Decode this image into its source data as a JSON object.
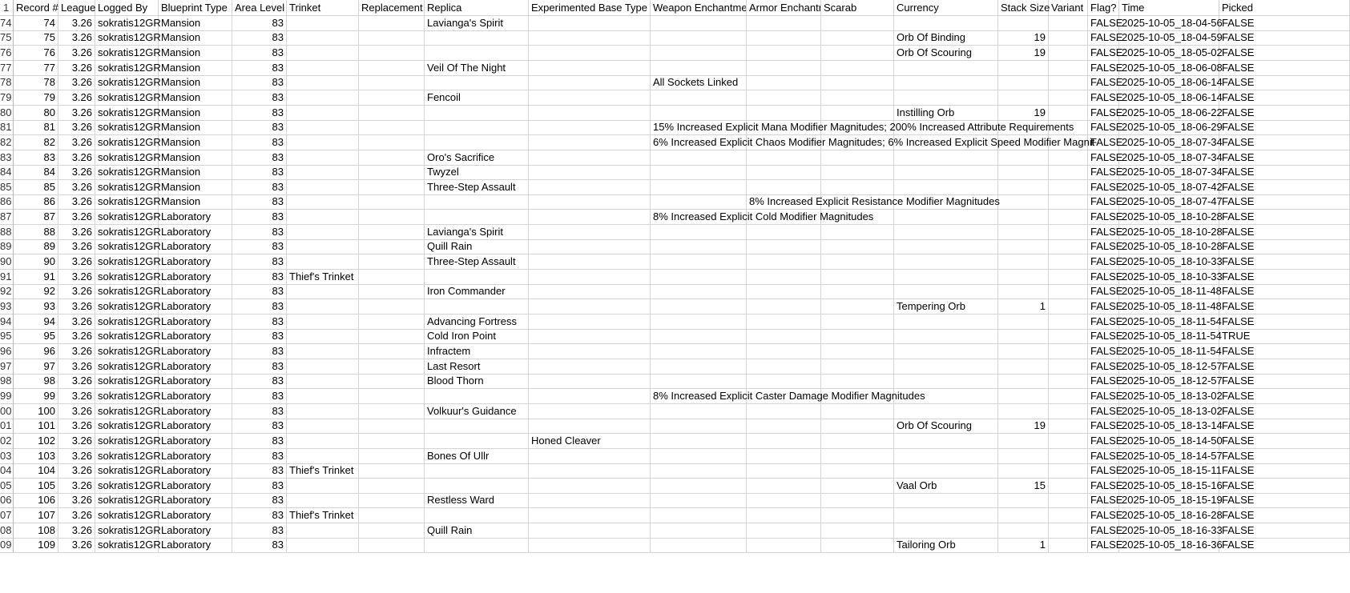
{
  "header": {
    "row_label": "1",
    "columns": [
      "Record #",
      "League",
      "Logged By",
      "Blueprint Type",
      "Area Level",
      "Trinket",
      "Replacement",
      "Replica",
      "Experimented Base Type",
      "Weapon Enchantme",
      "Armor Enchantm",
      "Scarab",
      "Currency",
      "Stack Size",
      "Variant",
      "Flag?",
      "Time",
      "Picked"
    ]
  },
  "rows": [
    [
      "74",
      "74",
      "3.26",
      "sokratis12GR",
      "Mansion",
      "83",
      "",
      "",
      "Lavianga's Spirit",
      "",
      "",
      "",
      "",
      "",
      "",
      "",
      "FALSE",
      "2025-10-05_18-04-56",
      "FALSE"
    ],
    [
      "75",
      "75",
      "3.26",
      "sokratis12GR",
      "Mansion",
      "83",
      "",
      "",
      "",
      "",
      "",
      "",
      "",
      "Orb Of Binding",
      "19",
      "",
      "FALSE",
      "2025-10-05_18-04-59",
      "FALSE"
    ],
    [
      "76",
      "76",
      "3.26",
      "sokratis12GR",
      "Mansion",
      "83",
      "",
      "",
      "",
      "",
      "",
      "",
      "",
      "Orb Of Scouring",
      "19",
      "",
      "FALSE",
      "2025-10-05_18-05-02",
      "FALSE"
    ],
    [
      "77",
      "77",
      "3.26",
      "sokratis12GR",
      "Mansion",
      "83",
      "",
      "",
      "Veil Of The Night",
      "",
      "",
      "",
      "",
      "",
      "",
      "",
      "FALSE",
      "2025-10-05_18-06-08",
      "FALSE"
    ],
    [
      "78",
      "78",
      "3.26",
      "sokratis12GR",
      "Mansion",
      "83",
      "",
      "",
      "",
      "",
      "All Sockets Linked",
      "",
      "",
      "",
      "",
      "",
      "FALSE",
      "2025-10-05_18-06-14",
      "FALSE"
    ],
    [
      "79",
      "79",
      "3.26",
      "sokratis12GR",
      "Mansion",
      "83",
      "",
      "",
      "Fencoil",
      "",
      "",
      "",
      "",
      "",
      "",
      "",
      "FALSE",
      "2025-10-05_18-06-14",
      "FALSE"
    ],
    [
      "80",
      "80",
      "3.26",
      "sokratis12GR",
      "Mansion",
      "83",
      "",
      "",
      "",
      "",
      "",
      "",
      "",
      "Instilling Orb",
      "19",
      "",
      "FALSE",
      "2025-10-05_18-06-22",
      "FALSE"
    ],
    [
      "81",
      "81",
      "3.26",
      "sokratis12GR",
      "Mansion",
      "83",
      "",
      "",
      "",
      "",
      "15% Increased Explicit Mana Modifier Magnitudes; 200% Increased Attribute Requirements",
      "",
      "",
      "",
      "",
      "",
      "FALSE",
      "2025-10-05_18-06-29",
      "FALSE"
    ],
    [
      "82",
      "82",
      "3.26",
      "sokratis12GR",
      "Mansion",
      "83",
      "",
      "",
      "",
      "",
      "6% Increased Explicit Chaos Modifier Magnitudes; 6% Increased Explicit Speed Modifier Magnit",
      "",
      "",
      "",
      "",
      "",
      "FALSE",
      "2025-10-05_18-07-34",
      "FALSE"
    ],
    [
      "83",
      "83",
      "3.26",
      "sokratis12GR",
      "Mansion",
      "83",
      "",
      "",
      "Oro's Sacrifice",
      "",
      "",
      "",
      "",
      "",
      "",
      "",
      "FALSE",
      "2025-10-05_18-07-34",
      "FALSE"
    ],
    [
      "84",
      "84",
      "3.26",
      "sokratis12GR",
      "Mansion",
      "83",
      "",
      "",
      "Twyzel",
      "",
      "",
      "",
      "",
      "",
      "",
      "",
      "FALSE",
      "2025-10-05_18-07-34",
      "FALSE"
    ],
    [
      "85",
      "85",
      "3.26",
      "sokratis12GR",
      "Mansion",
      "83",
      "",
      "",
      "Three-Step Assault",
      "",
      "",
      "",
      "",
      "",
      "",
      "",
      "FALSE",
      "2025-10-05_18-07-42",
      "FALSE"
    ],
    [
      "86",
      "86",
      "3.26",
      "sokratis12GR",
      "Mansion",
      "83",
      "",
      "",
      "",
      "",
      "",
      "8% Increased Explicit Resistance Modifier Magnitudes",
      "",
      "",
      "",
      "",
      "FALSE",
      "2025-10-05_18-07-47",
      "FALSE"
    ],
    [
      "87",
      "87",
      "3.26",
      "sokratis12GR",
      "Laboratory",
      "83",
      "",
      "",
      "",
      "",
      "8% Increased Explicit Cold Modifier Magnitudes",
      "",
      "",
      "",
      "",
      "",
      "FALSE",
      "2025-10-05_18-10-28",
      "FALSE"
    ],
    [
      "88",
      "88",
      "3.26",
      "sokratis12GR",
      "Laboratory",
      "83",
      "",
      "",
      "Lavianga's Spirit",
      "",
      "",
      "",
      "",
      "",
      "",
      "",
      "FALSE",
      "2025-10-05_18-10-28",
      "FALSE"
    ],
    [
      "89",
      "89",
      "3.26",
      "sokratis12GR",
      "Laboratory",
      "83",
      "",
      "",
      "Quill Rain",
      "",
      "",
      "",
      "",
      "",
      "",
      "",
      "FALSE",
      "2025-10-05_18-10-28",
      "FALSE"
    ],
    [
      "90",
      "90",
      "3.26",
      "sokratis12GR",
      "Laboratory",
      "83",
      "",
      "",
      "Three-Step Assault",
      "",
      "",
      "",
      "",
      "",
      "",
      "",
      "FALSE",
      "2025-10-05_18-10-33",
      "FALSE"
    ],
    [
      "91",
      "91",
      "3.26",
      "sokratis12GR",
      "Laboratory",
      "83",
      "Thief's Trinket",
      "",
      "",
      "",
      "",
      "",
      "",
      "",
      "",
      "",
      "FALSE",
      "2025-10-05_18-10-33",
      "FALSE"
    ],
    [
      "92",
      "92",
      "3.26",
      "sokratis12GR",
      "Laboratory",
      "83",
      "",
      "",
      "Iron Commander",
      "",
      "",
      "",
      "",
      "",
      "",
      "",
      "FALSE",
      "2025-10-05_18-11-48",
      "FALSE"
    ],
    [
      "93",
      "93",
      "3.26",
      "sokratis12GR",
      "Laboratory",
      "83",
      "",
      "",
      "",
      "",
      "",
      "",
      "",
      "Tempering Orb",
      "1",
      "",
      "FALSE",
      "2025-10-05_18-11-48",
      "FALSE"
    ],
    [
      "94",
      "94",
      "3.26",
      "sokratis12GR",
      "Laboratory",
      "83",
      "",
      "",
      "Advancing Fortress",
      "",
      "",
      "",
      "",
      "",
      "",
      "",
      "FALSE",
      "2025-10-05_18-11-54",
      "FALSE"
    ],
    [
      "95",
      "95",
      "3.26",
      "sokratis12GR",
      "Laboratory",
      "83",
      "",
      "",
      "Cold Iron Point",
      "",
      "",
      "",
      "",
      "",
      "",
      "",
      "FALSE",
      "2025-10-05_18-11-54",
      "TRUE"
    ],
    [
      "96",
      "96",
      "3.26",
      "sokratis12GR",
      "Laboratory",
      "83",
      "",
      "",
      "Infractem",
      "",
      "",
      "",
      "",
      "",
      "",
      "",
      "FALSE",
      "2025-10-05_18-11-54",
      "FALSE"
    ],
    [
      "97",
      "97",
      "3.26",
      "sokratis12GR",
      "Laboratory",
      "83",
      "",
      "",
      "Last Resort",
      "",
      "",
      "",
      "",
      "",
      "",
      "",
      "FALSE",
      "2025-10-05_18-12-57",
      "FALSE"
    ],
    [
      "98",
      "98",
      "3.26",
      "sokratis12GR",
      "Laboratory",
      "83",
      "",
      "",
      "Blood Thorn",
      "",
      "",
      "",
      "",
      "",
      "",
      "",
      "FALSE",
      "2025-10-05_18-12-57",
      "FALSE"
    ],
    [
      "99",
      "99",
      "3.26",
      "sokratis12GR",
      "Laboratory",
      "83",
      "",
      "",
      "",
      "",
      "8% Increased Explicit Caster Damage Modifier Magnitudes",
      "",
      "",
      "",
      "",
      "",
      "FALSE",
      "2025-10-05_18-13-02",
      "FALSE"
    ],
    [
      "00",
      "100",
      "3.26",
      "sokratis12GR",
      "Laboratory",
      "83",
      "",
      "",
      "Volkuur's Guidance",
      "",
      "",
      "",
      "",
      "",
      "",
      "",
      "FALSE",
      "2025-10-05_18-13-02",
      "FALSE"
    ],
    [
      "01",
      "101",
      "3.26",
      "sokratis12GR",
      "Laboratory",
      "83",
      "",
      "",
      "",
      "",
      "",
      "",
      "",
      "Orb Of Scouring",
      "19",
      "",
      "FALSE",
      "2025-10-05_18-13-14",
      "FALSE"
    ],
    [
      "02",
      "102",
      "3.26",
      "sokratis12GR",
      "Laboratory",
      "83",
      "",
      "",
      "",
      "Honed Cleaver",
      "",
      "",
      "",
      "",
      "",
      "",
      "FALSE",
      "2025-10-05_18-14-50",
      "FALSE"
    ],
    [
      "03",
      "103",
      "3.26",
      "sokratis12GR",
      "Laboratory",
      "83",
      "",
      "",
      "Bones Of Ullr",
      "",
      "",
      "",
      "",
      "",
      "",
      "",
      "FALSE",
      "2025-10-05_18-14-57",
      "FALSE"
    ],
    [
      "04",
      "104",
      "3.26",
      "sokratis12GR",
      "Laboratory",
      "83",
      "Thief's Trinket",
      "",
      "",
      "",
      "",
      "",
      "",
      "",
      "",
      "",
      "FALSE",
      "2025-10-05_18-15-11",
      "FALSE"
    ],
    [
      "05",
      "105",
      "3.26",
      "sokratis12GR",
      "Laboratory",
      "83",
      "",
      "",
      "",
      "",
      "",
      "",
      "",
      "Vaal Orb",
      "15",
      "",
      "FALSE",
      "2025-10-05_18-15-16",
      "FALSE"
    ],
    [
      "06",
      "106",
      "3.26",
      "sokratis12GR",
      "Laboratory",
      "83",
      "",
      "",
      "Restless Ward",
      "",
      "",
      "",
      "",
      "",
      "",
      "",
      "FALSE",
      "2025-10-05_18-15-19",
      "FALSE"
    ],
    [
      "07",
      "107",
      "3.26",
      "sokratis12GR",
      "Laboratory",
      "83",
      "Thief's Trinket",
      "",
      "",
      "",
      "",
      "",
      "",
      "",
      "",
      "",
      "FALSE",
      "2025-10-05_18-16-28",
      "FALSE"
    ],
    [
      "08",
      "108",
      "3.26",
      "sokratis12GR",
      "Laboratory",
      "83",
      "",
      "",
      "Quill Rain",
      "",
      "",
      "",
      "",
      "",
      "",
      "",
      "FALSE",
      "2025-10-05_18-16-33",
      "FALSE"
    ],
    [
      "09",
      "109",
      "3.26",
      "sokratis12GR",
      "Laboratory",
      "83",
      "",
      "",
      "",
      "",
      "",
      "",
      "",
      "Tailoring Orb",
      "1",
      "",
      "FALSE",
      "2025-10-05_18-16-36",
      "FALSE"
    ]
  ]
}
